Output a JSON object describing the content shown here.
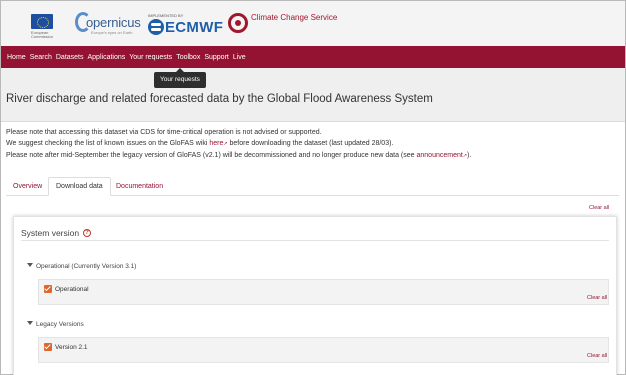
{
  "header": {
    "eu_caption": "European Commission",
    "copernicus_wordmark": "opernicus",
    "copernicus_tagline": "Europe's eyes on Earth",
    "ecmwf_caption": "IMPLEMENTED BY",
    "ecmwf_wordmark": "ECMWF",
    "c3s_name": "Climate Change Service"
  },
  "nav": {
    "items": [
      "Home",
      "Search",
      "Datasets",
      "Applications",
      "Your requests",
      "Toolbox",
      "Support",
      "Live"
    ],
    "tooltip": "Your requests"
  },
  "page": {
    "title": "River discharge and related forecasted data by the Global Flood Awareness System"
  },
  "notices": {
    "line1": "Please note that accessing this dataset via CDS for time-critical operation is not advised or supported.",
    "line2_pre": "We suggest checking the list of known issues on the GloFAS wiki ",
    "line2_link": "here",
    "line2_post": " before downloading the dataset (last updated 28/03).",
    "line3_pre": "Please note after mid-September the legacy version of GloFAS (v2.1) will be decommissioned and no longer produce new data (see ",
    "line3_link": "announcement",
    "line3_post": ")."
  },
  "tabs": [
    "Overview",
    "Download data",
    "Documentation"
  ],
  "clear_all_label": "Clear all",
  "system_version": {
    "title": "System version",
    "help_icon": "?",
    "groups": [
      {
        "label": "Operational (Currently Version 3.1)",
        "options": [
          {
            "label": "Operational",
            "checked": true
          }
        ]
      },
      {
        "label": "Legacy Versions",
        "options": [
          {
            "label": "Version 2.1",
            "checked": true
          }
        ]
      }
    ]
  },
  "colors": {
    "brand": "#941333",
    "checkbox": "#e1662c",
    "ecmwf_blue": "#1f5fa9"
  }
}
